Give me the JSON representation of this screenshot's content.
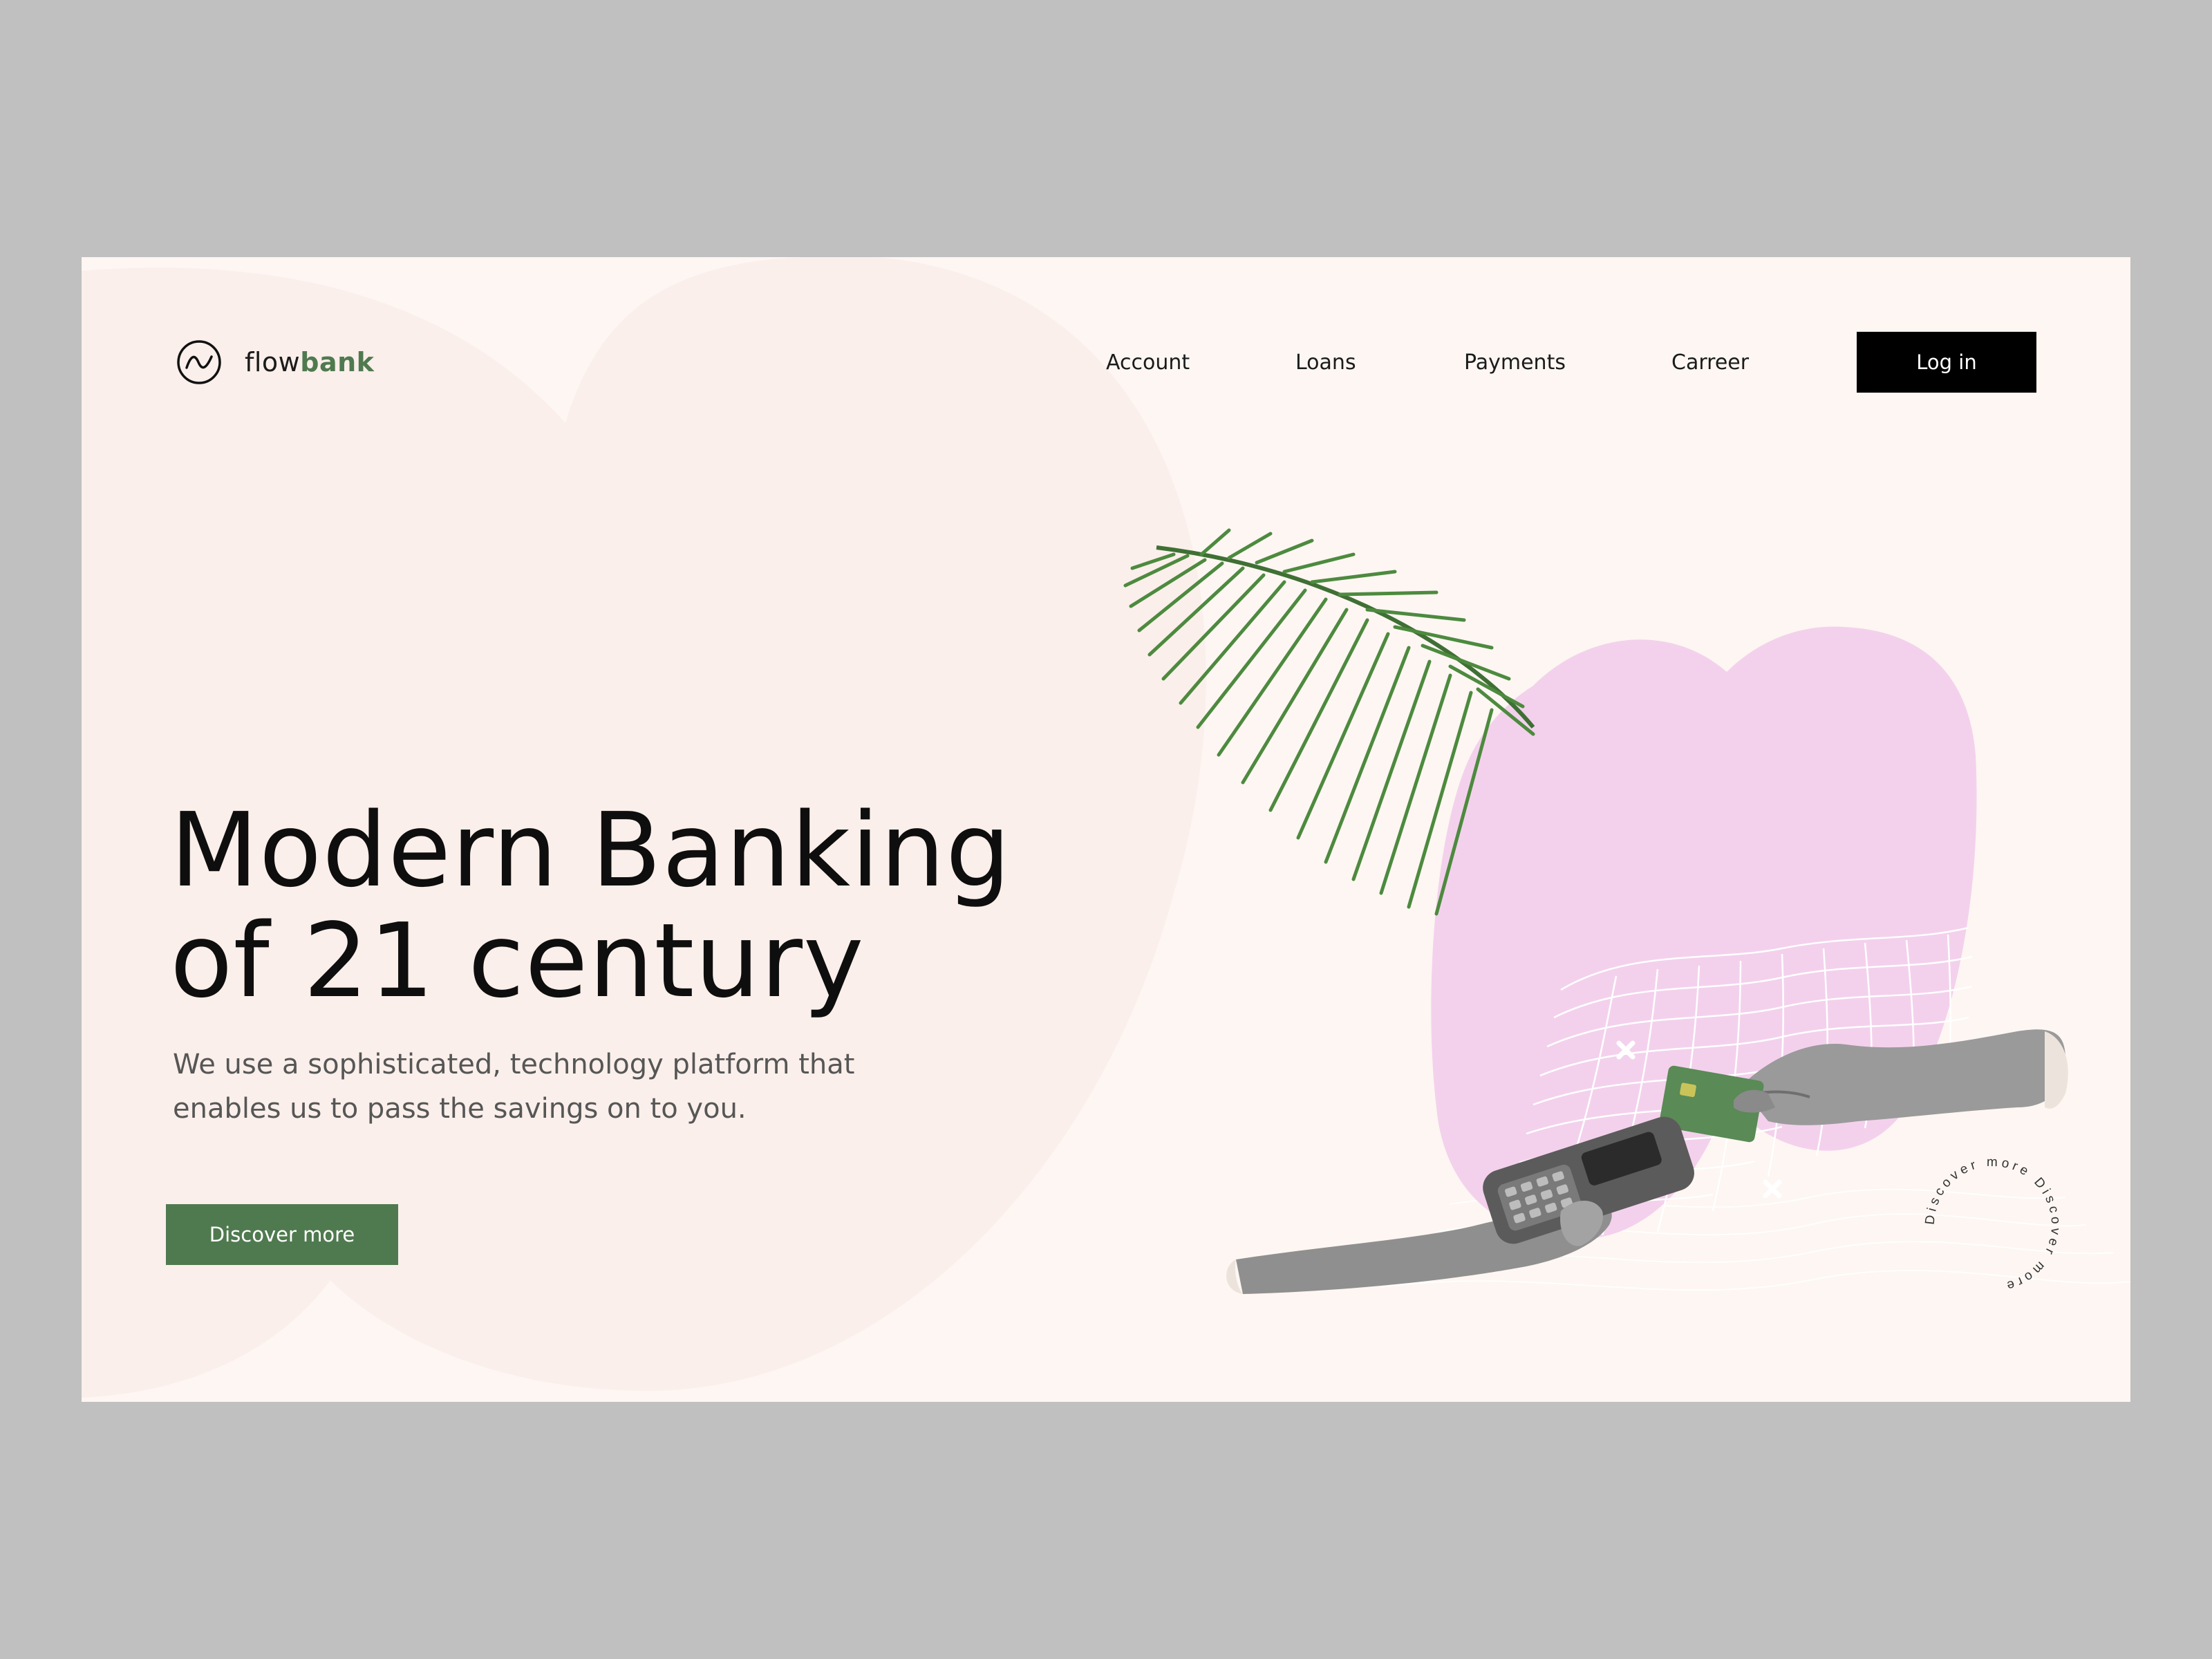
{
  "brand": {
    "name_prefix": "flow",
    "name_suffix": "bank",
    "logo_icon": "wave-circle-icon",
    "accent_color": "#4f7a4f"
  },
  "nav": {
    "items": [
      {
        "label": "Account"
      },
      {
        "label": "Loans"
      },
      {
        "label": "Payments"
      },
      {
        "label": "Carreer"
      }
    ],
    "login_label": "Log in"
  },
  "hero": {
    "title_line1": "Modern Banking",
    "title_line2": "of 21 century",
    "subtitle_line1": "We use a sophisticated, technology platform that",
    "subtitle_line2": "enables us to pass the savings on to you.",
    "cta_label": "Discover more",
    "circular_badge_text": "Discover more Discover more"
  },
  "colors": {
    "page_background": "#fdf6f2",
    "blob_pink": "#f3d1ec",
    "cta_green": "#4f7a4f",
    "login_black": "#000000",
    "card_green": "#5a8a56"
  }
}
